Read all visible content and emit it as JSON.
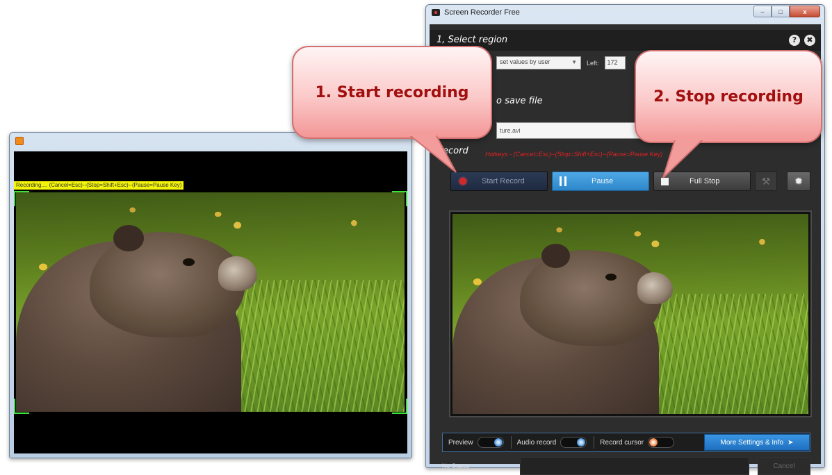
{
  "left_window": {
    "banner": "Recording.... (Cancel=Esc)--(Stop=Shift+Esc)--(Pause=Pause Key)"
  },
  "app": {
    "title": "Screen Recorder Free",
    "window_buttons": {
      "minimize": "–",
      "maximize": "□",
      "close": "x"
    }
  },
  "region": {
    "heading": "1, Select region",
    "help_icon": "?",
    "close_icon": "✖",
    "mode": "set values by user",
    "left_label": "Left:",
    "left_value": "172"
  },
  "save": {
    "heading_partial": "o save file",
    "filename_partial": "ture.avi"
  },
  "record": {
    "heading": "Record",
    "hotkeys": "Hotkeys - (Cancel=Esc)--(Stop=Shift+Esc)--(Pause=Pause Key)",
    "start_label": "Start Record",
    "pause_label": "Pause",
    "stop_label": "Full Stop",
    "tools_icon": "⚒",
    "gear_icon": "✹"
  },
  "options": {
    "preview_label": "Preview",
    "audio_label": "Audio record",
    "cursor_label": "Record cursor",
    "more_label": "More Settings & Info",
    "more_icon": "➤"
  },
  "status": {
    "text": "No Status",
    "cancel_label": "Cancel"
  },
  "callouts": {
    "start": "1. Start recording",
    "stop": "2. Stop recording"
  },
  "colors": {
    "callout_text": "#a10f0f",
    "record_heading": "#d22222",
    "accent_blue": "#2d86c8",
    "selection_green": "#3de23d",
    "banner_yellow": "#f4f40a"
  }
}
